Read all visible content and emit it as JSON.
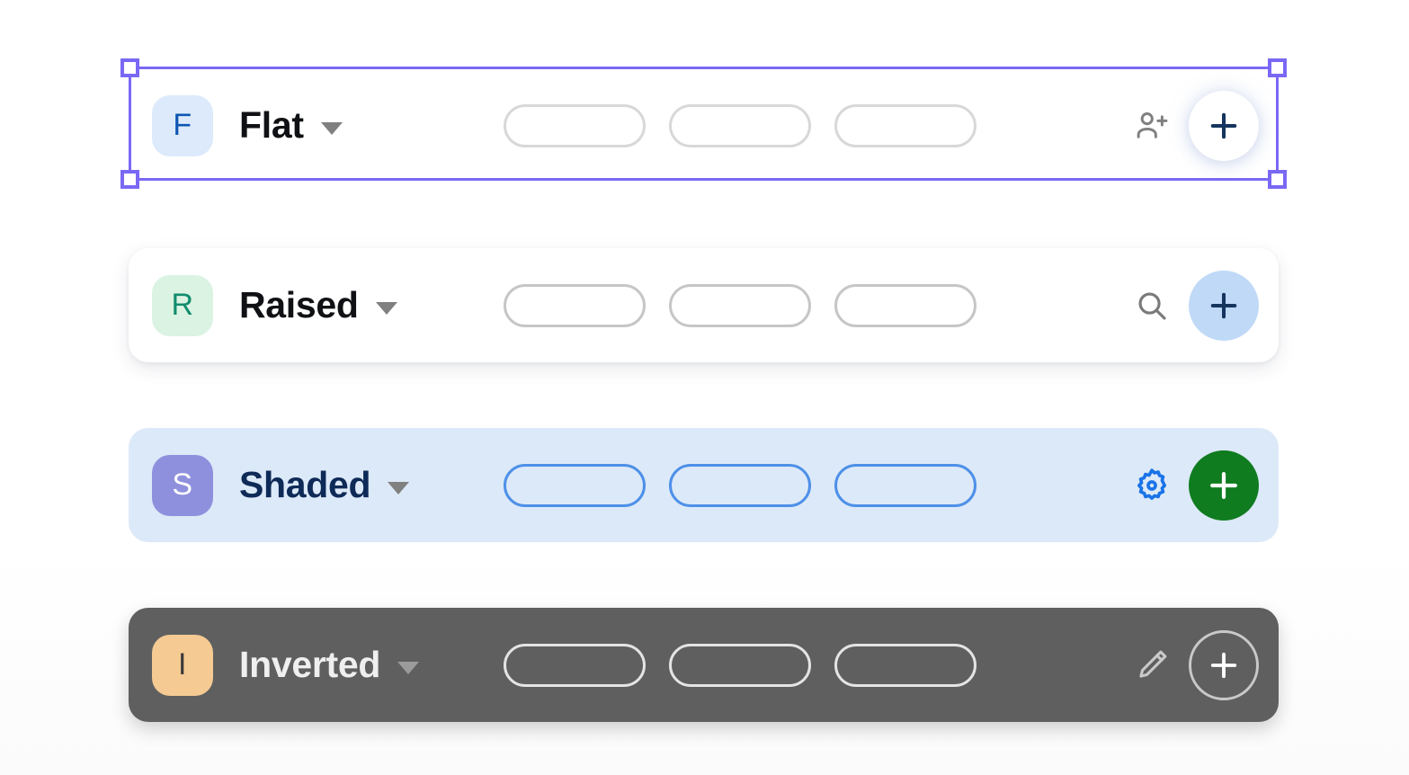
{
  "canvas": {
    "background_color": "#ffffff",
    "selection_color": "#7a68f5"
  },
  "selection": {
    "target_row": "Flat",
    "handles": [
      "top-left",
      "top-right",
      "bottom-left",
      "bottom-right"
    ]
  },
  "rows": [
    {
      "id": "flat",
      "variant_label": "Flat",
      "badge_letter": "F",
      "badge_bg": "#dceafb",
      "badge_fg": "#0f56b3",
      "row_bg": "#ffffff",
      "title_color": "#101114",
      "caret": "chevron-down-icon",
      "pill_count": 3,
      "pill_border": "#d8d8d8",
      "action_icon": "person-add-icon",
      "action_icon_color": "#808080",
      "plus_button": {
        "icon": "plus-icon",
        "bg": "#ffffff",
        "fg": "#15355f",
        "style": "elevated-glow"
      },
      "selected": true
    },
    {
      "id": "raised",
      "variant_label": "Raised",
      "badge_letter": "R",
      "badge_bg": "#dbf3e2",
      "badge_fg": "#128c6e",
      "row_bg": "#ffffff",
      "title_color": "#101114",
      "caret": "chevron-down-icon",
      "pill_count": 3,
      "pill_border": "#c6c6c6",
      "action_icon": "search-icon",
      "action_icon_color": "#7a7a7a",
      "plus_button": {
        "icon": "plus-icon",
        "bg": "#bfd9f7",
        "fg": "#15355f",
        "style": "tinted"
      },
      "selected": false
    },
    {
      "id": "shaded",
      "variant_label": "Shaded",
      "badge_letter": "S",
      "badge_bg": "#8f90dd",
      "badge_fg": "#ffffff",
      "row_bg": "#dce9f8",
      "title_color": "#0e2a57",
      "caret": "chevron-down-icon",
      "pill_count": 3,
      "pill_border": "#4d90e8",
      "action_icon": "gear-icon",
      "action_icon_color": "#1a73e8",
      "plus_button": {
        "icon": "plus-icon",
        "bg": "#0f7c1f",
        "fg": "#ffffff",
        "style": "solid"
      },
      "selected": false
    },
    {
      "id": "inverted",
      "variant_label": "Inverted",
      "badge_letter": "I",
      "badge_bg": "#f5cb93",
      "badge_fg": "#3a3a3a",
      "row_bg": "#5f5f5f",
      "title_color": "#efefef",
      "caret": "chevron-down-icon",
      "pill_count": 3,
      "pill_border": "#e4e4e4",
      "action_icon": "pencil-icon",
      "action_icon_color": "#c9c9c9",
      "plus_button": {
        "icon": "plus-icon",
        "bg": "transparent",
        "fg": "#ffffff",
        "style": "outlined"
      },
      "selected": false
    }
  ]
}
